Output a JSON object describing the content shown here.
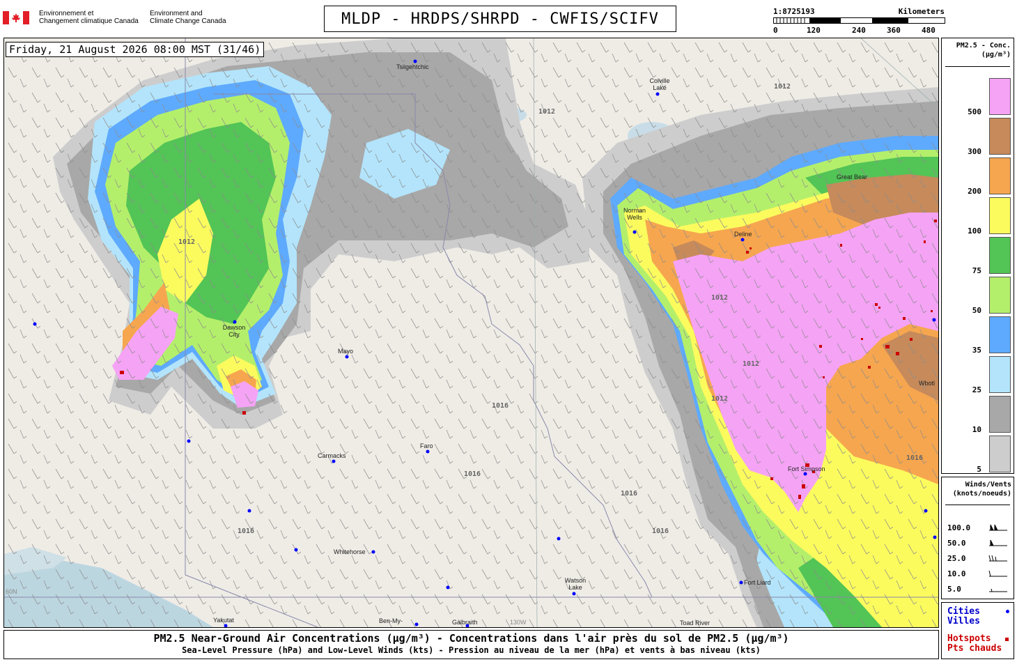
{
  "header": {
    "gov_fr": [
      "Environnement et",
      "Changement climatique Canada"
    ],
    "gov_en": [
      "Environment and",
      "Climate Change Canada"
    ],
    "title": "MLDP - HRDPS/SHRPD - CWFIS/SCIFV",
    "scale": {
      "ratio": "1:8725193",
      "unit": "Kilometers",
      "ticks": [
        "0",
        "120",
        "240",
        "360",
        "480"
      ]
    }
  },
  "map": {
    "datetime": "Friday, 21 August 2026 08:00 MST (31/46)",
    "cities": [
      "Tsiigehtchic",
      "Colville Lake",
      "Norman Wells",
      "Deline",
      "Dawson City",
      "Mayo",
      "Carmacks",
      "Faro",
      "Whitehorse",
      "Watson Lake",
      "Fort Liard",
      "Fort Simpson",
      "Yakutat",
      "Ben-My-",
      "Galbraith",
      "Toad River",
      "Wbotl",
      "Great Bear"
    ],
    "pressure_labels": [
      "1012",
      "1016"
    ],
    "coords": [
      "60N",
      "130W"
    ]
  },
  "pm_legend": {
    "title_1": "PM2.5 - Conc.",
    "title_2": "(µg/m³)",
    "bins": [
      {
        "label": "500",
        "color": "#f5a3f5"
      },
      {
        "label": "300",
        "color": "#c68a5b"
      },
      {
        "label": "200",
        "color": "#f6a64f"
      },
      {
        "label": "100",
        "color": "#fbfb5e"
      },
      {
        "label": "75",
        "color": "#53c456"
      },
      {
        "label": "50",
        "color": "#b4ef6b"
      },
      {
        "label": "35",
        "color": "#5eaafe"
      },
      {
        "label": "25",
        "color": "#b3e4fb"
      },
      {
        "label": "10",
        "color": "#a8a8a8"
      },
      {
        "label": "5",
        "color": "#cdcdcd"
      }
    ]
  },
  "wind_legend": {
    "title_1": "Winds/Vents",
    "title_2": "(knots/noeuds)",
    "speeds": [
      "100.0",
      "50.0",
      "25.0",
      "10.0",
      "5.0"
    ]
  },
  "symbols": {
    "cities": [
      "Cities",
      "Villes"
    ],
    "hotspots": [
      "Hotspots",
      "Pts chauds"
    ],
    "city_color": "#0000ff",
    "hotspot_color": "#cc0000"
  },
  "footer": {
    "line1": "PM2.5 Near-Ground Air Concentrations (µg/m³) - Concentrations dans l'air près du sol de PM2.5 (µg/m³)",
    "line2": "Sea-Level Pressure (hPa) and Low-Level Winds (kts) - Pression au niveau de la mer (hPa) et vents à bas niveau (kts)"
  }
}
